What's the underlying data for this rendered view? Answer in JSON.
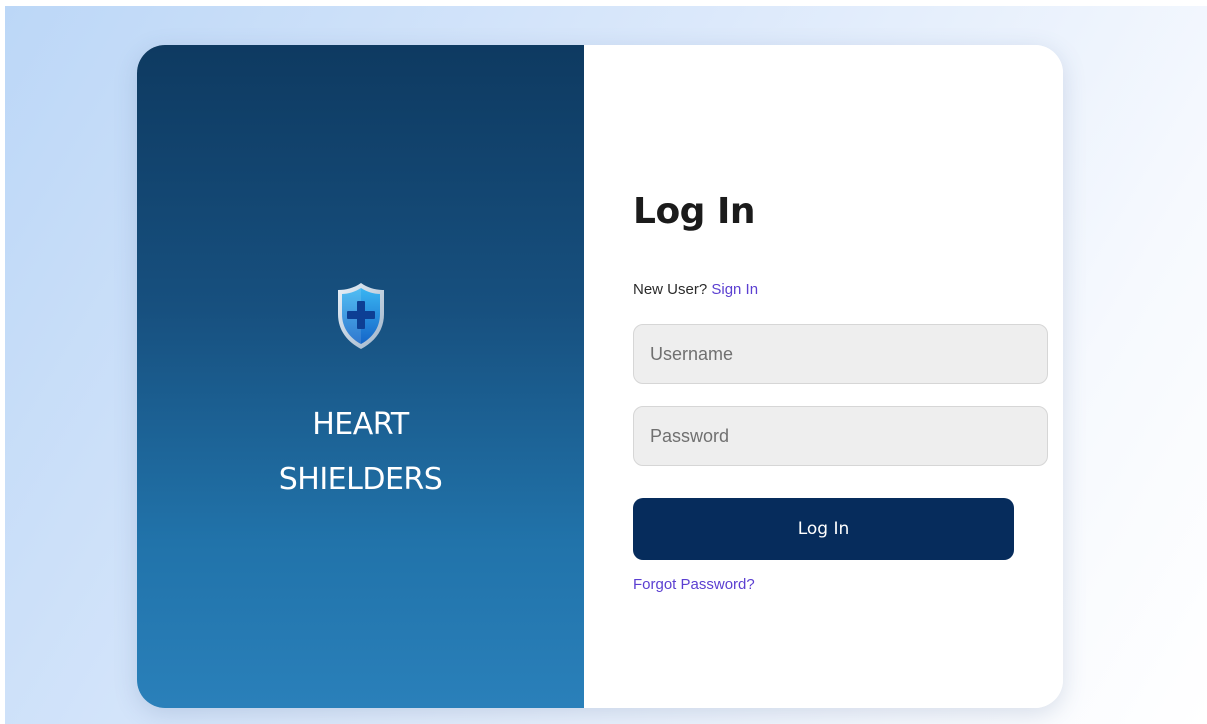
{
  "brand": {
    "name_line1": "HEART",
    "name_line2": "SHIELDERS",
    "logo_icon": "shield-plus-icon"
  },
  "login": {
    "title": "Log In",
    "new_user_prompt": "New User?",
    "sign_in_link": "Sign In",
    "username_placeholder": "Username",
    "password_placeholder": "Password",
    "submit_label": "Log In",
    "forgot_password_link": "Forgot Password?"
  },
  "colors": {
    "brand_panel_top": "#0e3a61",
    "brand_panel_bottom": "#2a80ba",
    "button": "#062c5c",
    "link": "#5b3fd1",
    "input_bg": "#eeeeee"
  }
}
